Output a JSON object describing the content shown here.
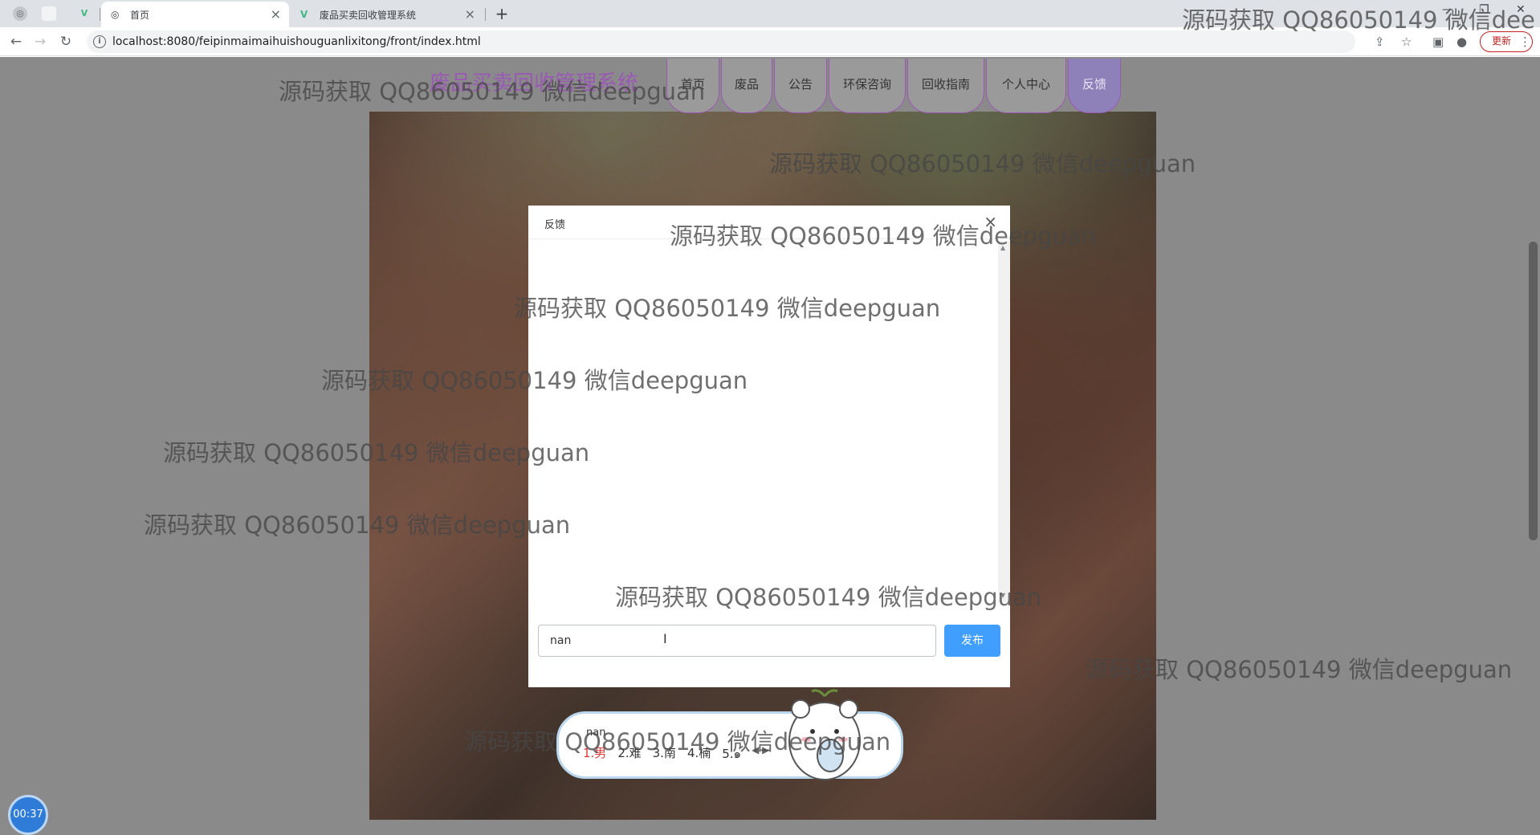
{
  "browser": {
    "tabs": [
      {
        "title": "首页",
        "active": true
      },
      {
        "title": "废品买卖回收管理系统",
        "active": false
      }
    ],
    "new_tab": "+",
    "url": "localhost:8080/feipinmaimaihuishouguanlixitong/front/index.html",
    "update_label": "更新",
    "accent_color": "#c5221f"
  },
  "site": {
    "title": "废品买卖回收管理系统",
    "nav": [
      {
        "label": "首页",
        "active": false
      },
      {
        "label": "废品",
        "active": false
      },
      {
        "label": "公告",
        "active": false
      },
      {
        "label": "环保咨询",
        "active": false
      },
      {
        "label": "回收指南",
        "active": false
      },
      {
        "label": "个人中心",
        "active": false
      },
      {
        "label": "反馈",
        "active": true
      }
    ],
    "brand_color": "#9b59b6"
  },
  "dialog": {
    "title": "反馈",
    "close": "×",
    "input_value": "nan",
    "send_label": "发布",
    "send_color": "#409eff"
  },
  "ime": {
    "composition": "nan",
    "candidates": [
      "1.男",
      "2.难",
      "3.南",
      "4.楠",
      "5.๑"
    ],
    "prev": "◀",
    "next": "▶"
  },
  "timer": "00:37",
  "watermark": "源码获取 QQ86050149 微信deepguan",
  "watermark_clipped": "源码获取 QQ86050149 微信dee"
}
